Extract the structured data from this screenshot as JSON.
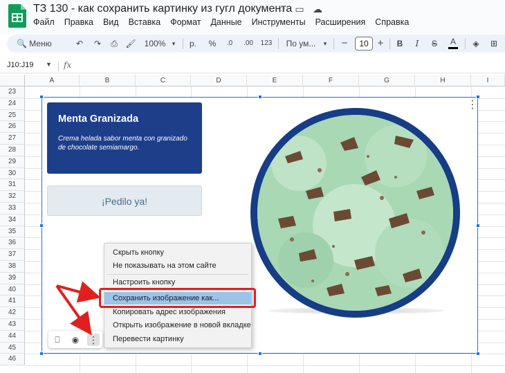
{
  "title": "ТЗ 130 - как сохранить картинку из гугл документа",
  "title_icons": [
    "star-icon",
    "folder-move-icon",
    "cloud-saved-icon"
  ],
  "menu": [
    "Файл",
    "Правка",
    "Вид",
    "Вставка",
    "Формат",
    "Данные",
    "Инструменты",
    "Расширения",
    "Справка"
  ],
  "toolbar": {
    "search_label": "Меню",
    "zoom": "100%",
    "currency": "р.",
    "percent": "%",
    "dec_decrease": ".0",
    "dec_increase": ".00",
    "number_format": "123",
    "font": "По ум...",
    "font_size": "10",
    "minus": "−",
    "plus": "+",
    "bold": "B",
    "italic": "I",
    "strike": "S",
    "text_color": "A"
  },
  "formula_bar": {
    "name_box": "J10:J19",
    "fx": "fx"
  },
  "columns": [
    "A",
    "B",
    "C",
    "D",
    "E",
    "F",
    "G",
    "H",
    "I"
  ],
  "rows": [
    "23",
    "24",
    "25",
    "26",
    "27",
    "28",
    "29",
    "30",
    "31",
    "32",
    "33",
    "34",
    "35",
    "36",
    "37",
    "38",
    "39",
    "40",
    "41",
    "42",
    "43",
    "44",
    "45",
    "46"
  ],
  "embed": {
    "card_title": "Menta Granizada",
    "card_text": "Crema helada sabor menta con granizado de chocolate semiamargo.",
    "cta": "¡Pedilo ya!"
  },
  "context_menu": {
    "items": [
      "Скрыть кнопку",
      "Не показывать на этом сайте",
      "Настроить кнопку",
      "Сохранить изображение как...",
      "Копировать адрес изображения",
      "Открыть изображение в новой вкладке",
      "Перевести картинку"
    ]
  },
  "colors": {
    "accent": "#1a73e8",
    "highlight": "#e02020",
    "card_blue": "#1d3f8a"
  }
}
